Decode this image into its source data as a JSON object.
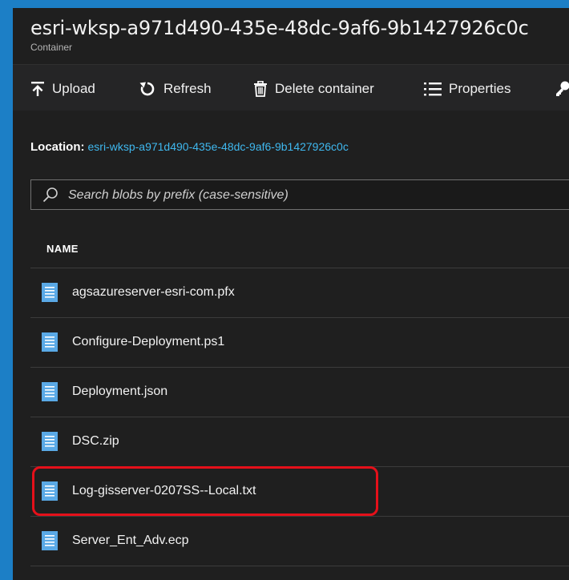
{
  "header": {
    "title": "esri-wksp-a971d490-435e-48dc-9af6-9b1427926c0c",
    "subtitle": "Container"
  },
  "toolbar": {
    "upload_label": "Upload",
    "refresh_label": "Refresh",
    "delete_label": "Delete container",
    "properties_label": "Properties"
  },
  "location": {
    "label": "Location:",
    "value": "esri-wksp-a971d490-435e-48dc-9af6-9b1427926c0c"
  },
  "search": {
    "placeholder": "Search blobs by prefix (case-sensitive)",
    "value": ""
  },
  "table": {
    "column_name": "NAME",
    "rows": [
      {
        "name": "agsazureserver-esri-com.pfx"
      },
      {
        "name": "Configure-Deployment.ps1"
      },
      {
        "name": "Deployment.json"
      },
      {
        "name": "DSC.zip"
      },
      {
        "name": "Log-gisserver-0207SS--Local.txt"
      },
      {
        "name": "Server_Ent_Adv.ecp"
      }
    ]
  },
  "colors": {
    "page_background": "#1c7fc6",
    "panel_background": "#1f1f1f",
    "link": "#3fb8ef",
    "highlight": "#e5101a",
    "file_icon": "#5aa9e6"
  },
  "icons": {
    "upload": "upload-icon",
    "refresh": "refresh-icon",
    "delete": "trash-icon",
    "properties": "list-icon",
    "access": "key-icon",
    "search": "search-icon",
    "file": "file-icon"
  }
}
